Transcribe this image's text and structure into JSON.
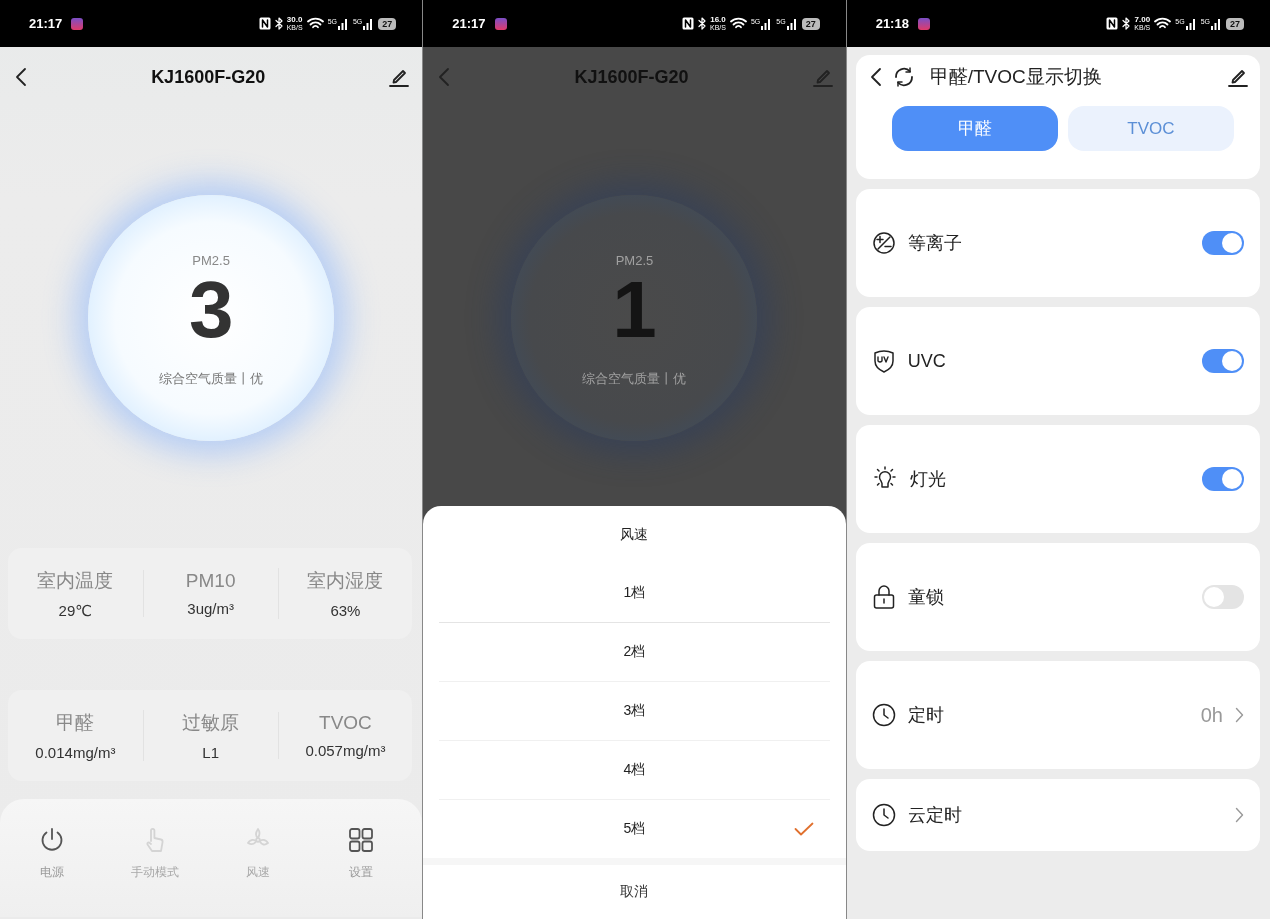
{
  "screens": [
    {
      "kind": "dashboard",
      "status_bar": {
        "time": "21:17",
        "speed": "30.0",
        "speed_unit": "KB/S",
        "networks": [
          "5G",
          "5G"
        ],
        "battery": "27"
      },
      "header": {
        "title": "KJ1600F-G20"
      },
      "gauge": {
        "label": "PM2.5",
        "value": "3",
        "caption": "综合空气质量丨优"
      },
      "metric_cards": [
        [
          {
            "label": "室内温度",
            "value": "29℃"
          },
          {
            "label": "PM10",
            "value": "3ug/m³"
          },
          {
            "label": "室内湿度",
            "value": "63%"
          }
        ],
        [
          {
            "label": "甲醛",
            "value": "0.014mg/m³"
          },
          {
            "label": "过敏原",
            "value": "L1"
          },
          {
            "label": "TVOC",
            "value": "0.057mg/m³"
          }
        ]
      ],
      "bottom_bar": [
        {
          "label": "电源",
          "disabled": false
        },
        {
          "label": "手动模式",
          "disabled": true
        },
        {
          "label": "风速",
          "disabled": true
        },
        {
          "label": "设置",
          "disabled": false
        }
      ]
    },
    {
      "kind": "dashboard_sheet",
      "status_bar": {
        "time": "21:17",
        "speed": "16.0",
        "speed_unit": "KB/S",
        "networks": [
          "5G",
          "5G"
        ],
        "battery": "27"
      },
      "header": {
        "title": "KJ1600F-G20"
      },
      "gauge": {
        "label": "PM2.5",
        "value": "1",
        "caption": "综合空气质量丨优"
      },
      "sheet": {
        "title": "风速",
        "options": [
          {
            "label": "1档",
            "selected": false
          },
          {
            "label": "2档",
            "selected": false
          },
          {
            "label": "3档",
            "selected": false
          },
          {
            "label": "4档",
            "selected": false
          },
          {
            "label": "5档",
            "selected": true
          }
        ],
        "cancel": "取消"
      }
    },
    {
      "kind": "settings",
      "status_bar": {
        "time": "21:18",
        "speed": "7.00",
        "speed_unit": "KB/S",
        "networks": [
          "5G",
          "5G"
        ],
        "battery": "27"
      },
      "header": {
        "title": "甲醛/TVOC显示切换"
      },
      "segments": [
        {
          "label": "甲醛",
          "selected": true
        },
        {
          "label": "TVOC",
          "selected": false
        }
      ],
      "rows": [
        {
          "kind": "toggle",
          "label": "等离子",
          "on": true
        },
        {
          "kind": "toggle",
          "label": "UVC",
          "on": true
        },
        {
          "kind": "toggle",
          "label": "灯光",
          "on": true
        },
        {
          "kind": "toggle",
          "label": "童锁",
          "on": false
        },
        {
          "kind": "link",
          "label": "定时",
          "value": "0h"
        },
        {
          "kind": "link",
          "label": "云定时"
        }
      ]
    }
  ]
}
